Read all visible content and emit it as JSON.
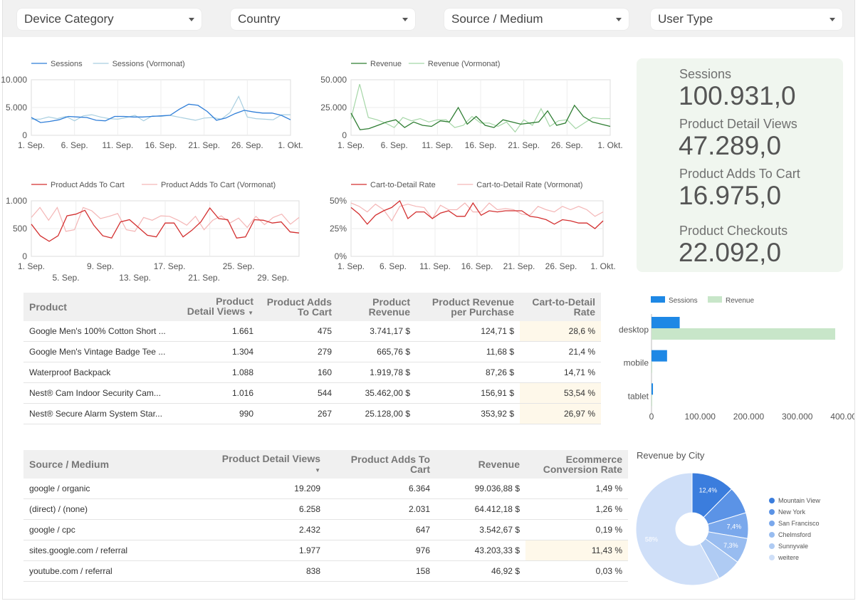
{
  "filters": [
    "Device Category",
    "Country",
    "Source / Medium",
    "User Type"
  ],
  "line_charts": [
    {
      "id": "sessions",
      "color_main": "#2f7ed8",
      "color_prev": "#a9cfe0",
      "legend": [
        "Sessions",
        "Sessions (Vormonat)"
      ],
      "y_ticks": [
        "10.000",
        "5.000",
        "0"
      ],
      "ymax": 10000,
      "x_ticks": [
        "1. Sep.",
        "6. Sep.",
        "11. Sep.",
        "16. Sep.",
        "21. Sep.",
        "26. Sep.",
        "1. Okt."
      ],
      "main": [
        3200,
        2300,
        2500,
        2800,
        3400,
        3300,
        3200,
        2700,
        2600,
        3400,
        3400,
        3300,
        3300,
        3400,
        3500,
        3600,
        4700,
        5600,
        5400,
        4300,
        2700,
        3100,
        3900,
        4500,
        4200,
        4000,
        4000,
        3600,
        2800
      ],
      "prev": [
        2900,
        2900,
        3300,
        3000,
        3400,
        2600,
        3500,
        3700,
        3300,
        3000,
        2900,
        3200,
        3600,
        2600,
        3500,
        3400,
        3600,
        3300,
        3000,
        2700,
        3100,
        3200,
        2900,
        4100,
        7000,
        3300,
        3000,
        2900,
        2800,
        3700,
        3700
      ]
    },
    {
      "id": "revenue",
      "color_main": "#2e7d32",
      "color_prev": "#a5d6a7",
      "legend": [
        "Revenue",
        "Revenue (Vormonat)"
      ],
      "y_ticks": [
        "50.000",
        "25.000",
        "0"
      ],
      "ymax": 50000,
      "x_ticks": [
        "1. Sep.",
        "6. Sep.",
        "11. Sep.",
        "16. Sep.",
        "21. Sep.",
        "26. Sep.",
        "1. Okt."
      ],
      "main": [
        20000,
        5000,
        6000,
        9000,
        12000,
        14000,
        7000,
        12000,
        9000,
        8000,
        13000,
        12000,
        25000,
        10000,
        17000,
        9000,
        7000,
        14000,
        12000,
        10000,
        11000,
        12000,
        22000,
        9000,
        11000,
        27000,
        17000,
        12000,
        10000,
        8000
      ],
      "prev": [
        15000,
        46000,
        16000,
        14000,
        11000,
        7000,
        16000,
        13000,
        15000,
        12000,
        14000,
        14000,
        7000,
        9000,
        17000,
        11000,
        11000,
        8000,
        12000,
        3000,
        14000,
        9000,
        24000,
        8000,
        13000,
        14000,
        6000,
        11000,
        16000,
        15000,
        15000
      ]
    },
    {
      "id": "addtocart",
      "color_main": "#d32f2f",
      "color_prev": "#f4b6b6",
      "legend": [
        "Product Adds To Cart",
        "Product Adds To Cart (Vormonat)"
      ],
      "y_ticks": [
        "1.000",
        "500",
        "0"
      ],
      "ymax": 1000,
      "x_ticks_row1": [
        "1. Sep.",
        "9. Sep.",
        "17. Sep.",
        "25. Sep."
      ],
      "x_ticks_row2": [
        "5. Sep.",
        "13. Sep.",
        "21. Sep.",
        "29. Sep."
      ],
      "main": [
        580,
        370,
        270,
        370,
        730,
        760,
        830,
        560,
        370,
        330,
        620,
        660,
        520,
        380,
        350,
        600,
        600,
        350,
        470,
        620,
        870,
        680,
        660,
        330,
        350,
        660,
        650,
        600,
        620,
        440,
        420
      ],
      "prev": [
        700,
        880,
        650,
        880,
        450,
        480,
        880,
        820,
        680,
        720,
        770,
        480,
        450,
        700,
        650,
        730,
        720,
        650,
        560,
        720,
        480,
        650,
        730,
        600,
        690,
        520,
        720,
        570,
        700,
        760,
        580,
        700
      ]
    },
    {
      "id": "cartrate",
      "color_main": "#d32f2f",
      "color_prev": "#f4b6b6",
      "legend": [
        "Cart-to-Detail Rate",
        "Cart-to-Detail Rate (Vormonat)"
      ],
      "y_ticks": [
        "50%",
        "25%",
        "0%"
      ],
      "ymax": 50,
      "x_ticks": [
        "1. Sep.",
        "6. Sep.",
        "11. Sep.",
        "16. Sep.",
        "21. Sep.",
        "26. Sep.",
        "1. Okt."
      ],
      "main": [
        44,
        38,
        29,
        37,
        41,
        44,
        50,
        34,
        40,
        40,
        34,
        39,
        41,
        36,
        36,
        48,
        37,
        41,
        40,
        41,
        41,
        41,
        36,
        35,
        33,
        29,
        33,
        32,
        30,
        30,
        25,
        32
      ],
      "prev": [
        48,
        45,
        40,
        47,
        42,
        32,
        45,
        47,
        45,
        44,
        34,
        46,
        42,
        42,
        48,
        40,
        40,
        48,
        42,
        43,
        42,
        38,
        37,
        45,
        42,
        40,
        45,
        42,
        45,
        42,
        36,
        40
      ]
    }
  ],
  "kpis": [
    {
      "label": "Sessions",
      "value": "100.931,0"
    },
    {
      "label": "Product Detail Views",
      "value": "47.289,0"
    },
    {
      "label": "Product Adds To Cart",
      "value": "16.975,0"
    },
    {
      "label": "Product Checkouts",
      "value": "22.092,0"
    }
  ],
  "product_table": {
    "headers": [
      "Product",
      "Product Detail Views",
      "Product Adds To Cart",
      "Product Revenue",
      "Product Revenue per Purchase",
      "Cart-to-Detail Rate"
    ],
    "rows": [
      [
        "Google Men's 100% Cotton Short ...",
        "1.661",
        "475",
        "3.741,17 $",
        "124,71 $",
        "28,6 %"
      ],
      [
        "Google Men's Vintage Badge Tee ...",
        "1.304",
        "279",
        "665,76 $",
        "11,68 $",
        "21,4 %"
      ],
      [
        "Waterproof Backpack",
        "1.088",
        "160",
        "1.919,78 $",
        "87,26 $",
        "14,71 %"
      ],
      [
        "Nest® Cam Indoor Security Cam...",
        "1.016",
        "544",
        "35.462,00 $",
        "156,91 $",
        "53,54 %"
      ],
      [
        "Nest® Secure Alarm System Star...",
        "990",
        "267",
        "25.128,00 $",
        "353,92 $",
        "26,97 %"
      ]
    ],
    "highlight_rate": [
      true,
      false,
      false,
      true,
      true
    ]
  },
  "source_table": {
    "headers": [
      "Source / Medium",
      "Product Detail Views",
      "Product Adds To Cart",
      "Revenue",
      "Ecommerce Conversion Rate"
    ],
    "rows": [
      [
        "google / organic",
        "19.209",
        "6.364",
        "99.036,88 $",
        "1,49 %"
      ],
      [
        "(direct) / (none)",
        "6.258",
        "2.031",
        "64.412,18 $",
        "1,26 %"
      ],
      [
        "google / cpc",
        "2.432",
        "647",
        "3.542,67 $",
        "0,19 %"
      ],
      [
        "sites.google.com / referral",
        "1.977",
        "976",
        "43.203,33 $",
        "11,43 %"
      ],
      [
        "youtube.com / referral",
        "838",
        "158",
        "46,92 $",
        "0,03 %"
      ]
    ],
    "highlight_rate": [
      false,
      false,
      false,
      true,
      false
    ]
  },
  "chart_data": [
    {
      "type": "bar",
      "orientation": "horizontal",
      "categories": [
        "desktop",
        "mobile",
        "tablet"
      ],
      "series": [
        {
          "name": "Sessions",
          "values": [
            58000,
            32000,
            3000
          ],
          "color": "#1e88e5"
        },
        {
          "name": "Revenue",
          "values": [
            378000,
            1500,
            300
          ],
          "color": "#c8e6c9"
        }
      ],
      "x_ticks": [
        "0",
        "100.000",
        "200.000",
        "300.000",
        "400.000"
      ],
      "xlim": [
        0,
        400000
      ],
      "legend_position": "top"
    },
    {
      "type": "pie",
      "title": "Revenue by City",
      "donut": true,
      "slices": [
        {
          "label": "Mountain View",
          "value": 12.4,
          "display": "12,4%",
          "color": "#3b7ddd"
        },
        {
          "label": "New York",
          "value": 7.9,
          "display": "",
          "color": "#5b93e6"
        },
        {
          "label": "San Francisco",
          "value": 7.4,
          "display": "7,4%",
          "color": "#7aa8ec"
        },
        {
          "label": "Chelmsford",
          "value": 7.3,
          "display": "7,3%",
          "color": "#98bcf0"
        },
        {
          "label": "Sunnyvale",
          "value": 7.0,
          "display": "",
          "color": "#afcbf3"
        },
        {
          "label": "weitere",
          "value": 58.0,
          "display": "58%",
          "color": "#cfdff8"
        }
      ],
      "legend_position": "right"
    }
  ]
}
